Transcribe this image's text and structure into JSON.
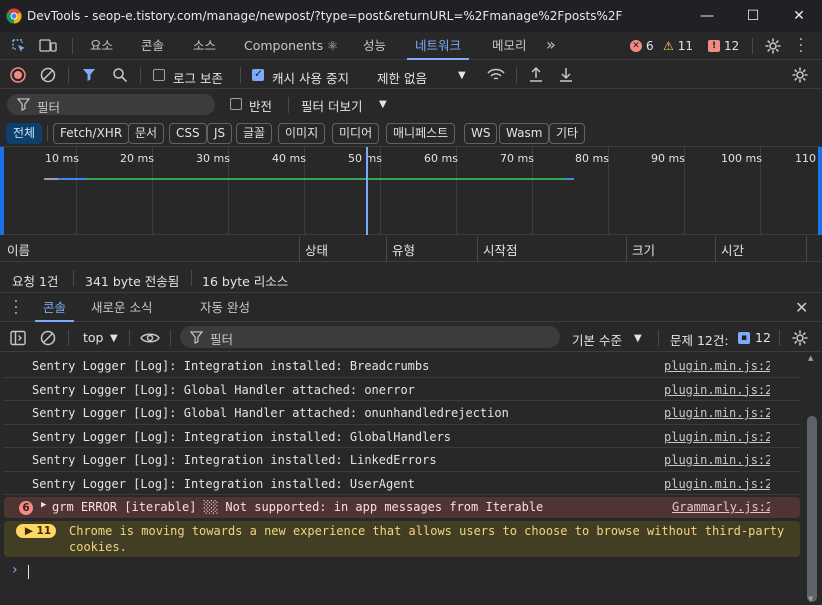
{
  "window": {
    "app_name": "DevTools",
    "url_title": "seop-e.tistory.com/manage/newpost/?type=post&returnURL=%2Fmanage%2Fposts%2F",
    "minimize": "—",
    "maximize": "☐",
    "close": "✕"
  },
  "tabs": [
    "요소",
    "콘솔",
    "소스",
    "Components ⚛",
    "성능",
    "네트워크",
    "메모리"
  ],
  "tabs_more": "»",
  "counters": {
    "errors": "6",
    "warnings": "11",
    "issues": "12"
  },
  "network_toolbar": {
    "preserve_log": "로그 보존",
    "disable_cache": "캐시 사용 중지",
    "throttling": "제한 없음"
  },
  "filter": {
    "placeholder": "필터",
    "invert": "반전",
    "more_filters": "필터 더보기"
  },
  "type_chips": [
    "전체",
    "Fetch/XHR",
    "문서",
    "CSS",
    "JS",
    "글꼴",
    "이미지",
    "미디어",
    "매니페스트",
    "WS",
    "Wasm",
    "기타"
  ],
  "timeline_ticks": [
    "10 ms",
    "20 ms",
    "30 ms",
    "40 ms",
    "50 ms",
    "60 ms",
    "70 ms",
    "80 ms",
    "90 ms",
    "100 ms",
    "110"
  ],
  "columns": [
    "이름",
    "상태",
    "유형",
    "시작점",
    "크기",
    "시간"
  ],
  "summary": {
    "requests": "요청 1건",
    "transferred": "341 byte 전송됨",
    "resources": "16 byte 리소스"
  },
  "drawer_tabs": [
    "콘솔",
    "새로운 소식",
    "자동 완성"
  ],
  "console_toolbar": {
    "context": "top",
    "filter_placeholder": "필터",
    "levels": "기본 수준",
    "issues_label": "문제 12건:",
    "issues_count": "12"
  },
  "console_messages": [
    {
      "text": "Sentry Logger [Log]: Integration installed: Breadcrumbs",
      "source": "plugin.min.js:2"
    },
    {
      "text": "Sentry Logger [Log]: Global Handler attached: onerror",
      "source": "plugin.min.js:2"
    },
    {
      "text": "Sentry Logger [Log]: Global Handler attached: onunhandledrejection",
      "source": "plugin.min.js:2"
    },
    {
      "text": "Sentry Logger [Log]: Integration installed: GlobalHandlers",
      "source": "plugin.min.js:2"
    },
    {
      "text": "Sentry Logger [Log]: Integration installed: LinkedErrors",
      "source": "plugin.min.js:2"
    },
    {
      "text": "Sentry Logger [Log]: Integration installed: UserAgent",
      "source": "plugin.min.js:2"
    }
  ],
  "error_message": {
    "count": "6",
    "text": "grm ERROR [iterable] ░░ Not supported: in app messages from Iterable",
    "source": "Grammarly.js:2"
  },
  "warning_message": {
    "count": "11",
    "line1": "Chrome is moving towards a new experience that allows users to choose to browse without third-party",
    "line2": "cookies."
  },
  "prompt": "›",
  "colors": {
    "accent": "#7cacf8",
    "error": "#f28b82",
    "warning": "#fdd663",
    "background": "#282828"
  }
}
